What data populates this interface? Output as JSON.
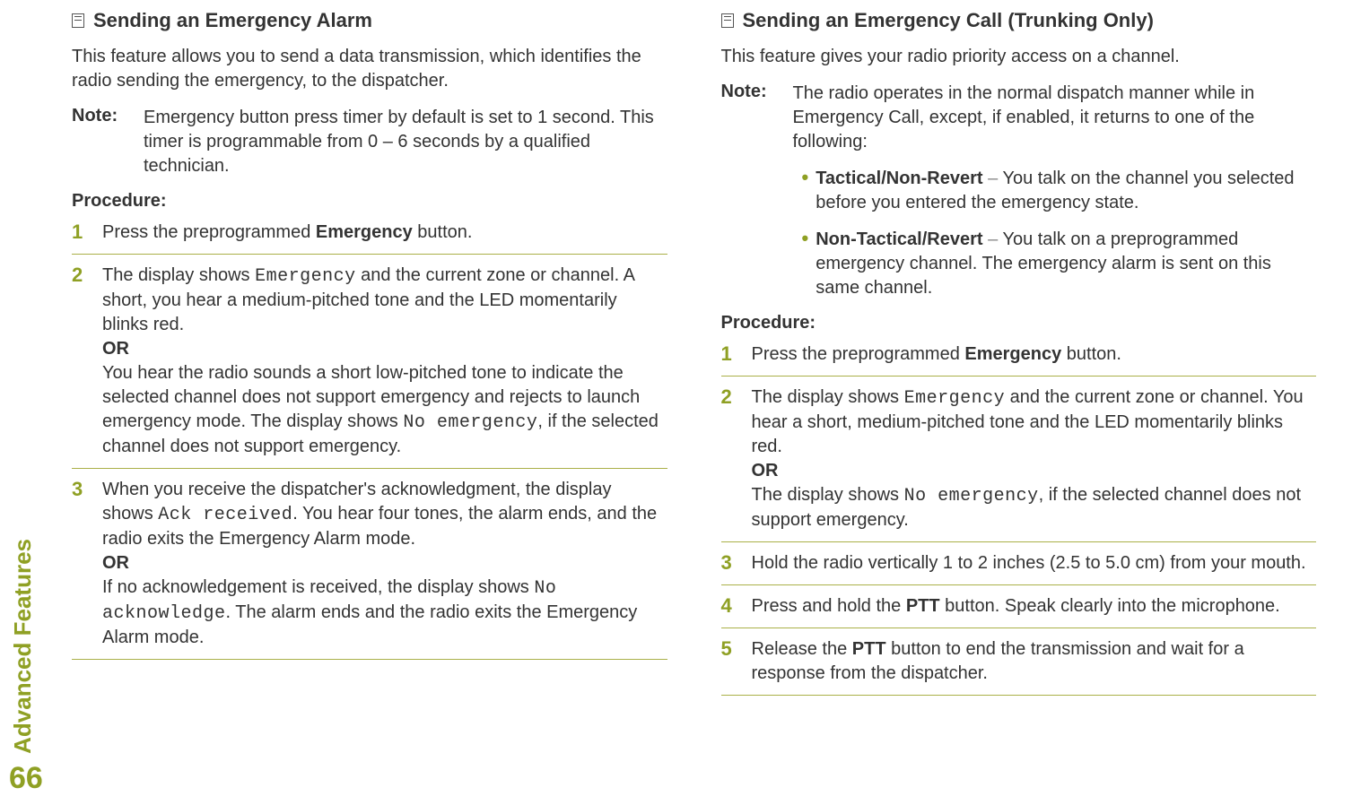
{
  "sidebar": {
    "label": "Advanced Features",
    "page": "66"
  },
  "left": {
    "title": "Sending an Emergency Alarm",
    "intro": "This feature allows you to send a data transmission, which identifies the radio sending the emergency, to the dispatcher.",
    "noteLabel": "Note:",
    "noteBody": "Emergency button press timer by default is set to 1 second. This timer is programmable from 0 – 6 seconds by a qualified technician.",
    "procedureLabel": "Procedure:",
    "steps": {
      "s1": {
        "num": "1",
        "pre": "Press the preprogrammed ",
        "bold": "Emergency",
        "post": " button."
      },
      "s2": {
        "num": "2",
        "a_pre": "The display shows ",
        "a_mono": "Emergency",
        "a_post": " and the current zone or channel. A short, you hear a medium-pitched tone and the LED momentarily blinks red.",
        "or": "OR",
        "b_pre": "You hear the radio sounds a short low-pitched tone to indicate the selected channel does not support emergency and rejects to launch emergency mode. The display shows ",
        "b_mono": "No emergency",
        "b_post": ", if the selected channel does not support emergency."
      },
      "s3": {
        "num": "3",
        "a_pre": "When you receive the dispatcher's acknowledgment, the display shows ",
        "a_mono": "Ack received",
        "a_post": ". You hear four tones, the alarm ends, and the radio exits the Emergency Alarm mode.",
        "or": "OR",
        "b_pre": "If no acknowledgement is received, the display shows ",
        "b_mono": "No acknowledge",
        "b_post": ". The alarm ends and the radio exits the Emergency Alarm mode."
      }
    }
  },
  "right": {
    "title": "Sending an Emergency Call (Trunking Only)",
    "intro": "This feature gives your radio priority access on a channel.",
    "noteLabel": "Note:",
    "noteBody": "The radio operates in the normal dispatch manner while in Emergency Call, except, if enabled, it returns to one of the following:",
    "bullets": {
      "b1": {
        "bold": "Tactical/Non-Revert",
        "dash": " – ",
        "rest": "You talk on the channel you selected before you entered the emergency state."
      },
      "b2": {
        "bold": "Non-Tactical/Revert",
        "dash": " – ",
        "rest": "You talk on a preprogrammed emergency channel. The emergency alarm is sent on this same channel."
      }
    },
    "procedureLabel": "Procedure:",
    "steps": {
      "s1": {
        "num": "1",
        "pre": "Press the preprogrammed ",
        "bold": "Emergency",
        "post": " button."
      },
      "s2": {
        "num": "2",
        "a_pre": "The display shows ",
        "a_mono": "Emergency",
        "a_post": " and the current zone or channel. You hear a short, medium-pitched tone and the LED momentarily blinks red.",
        "or": "OR",
        "b_pre": "The display shows ",
        "b_mono": "No emergency",
        "b_post": ", if the selected channel does not support emergency."
      },
      "s3": {
        "num": "3",
        "text": "Hold the radio vertically 1 to 2 inches (2.5 to 5.0 cm) from your mouth."
      },
      "s4": {
        "num": "4",
        "pre": "Press and hold the ",
        "bold": "PTT",
        "post": " button. Speak clearly into the microphone."
      },
      "s5": {
        "num": "5",
        "pre": "Release the ",
        "bold": "PTT",
        "post": " button to end the transmission and wait for a response from the dispatcher."
      }
    }
  }
}
